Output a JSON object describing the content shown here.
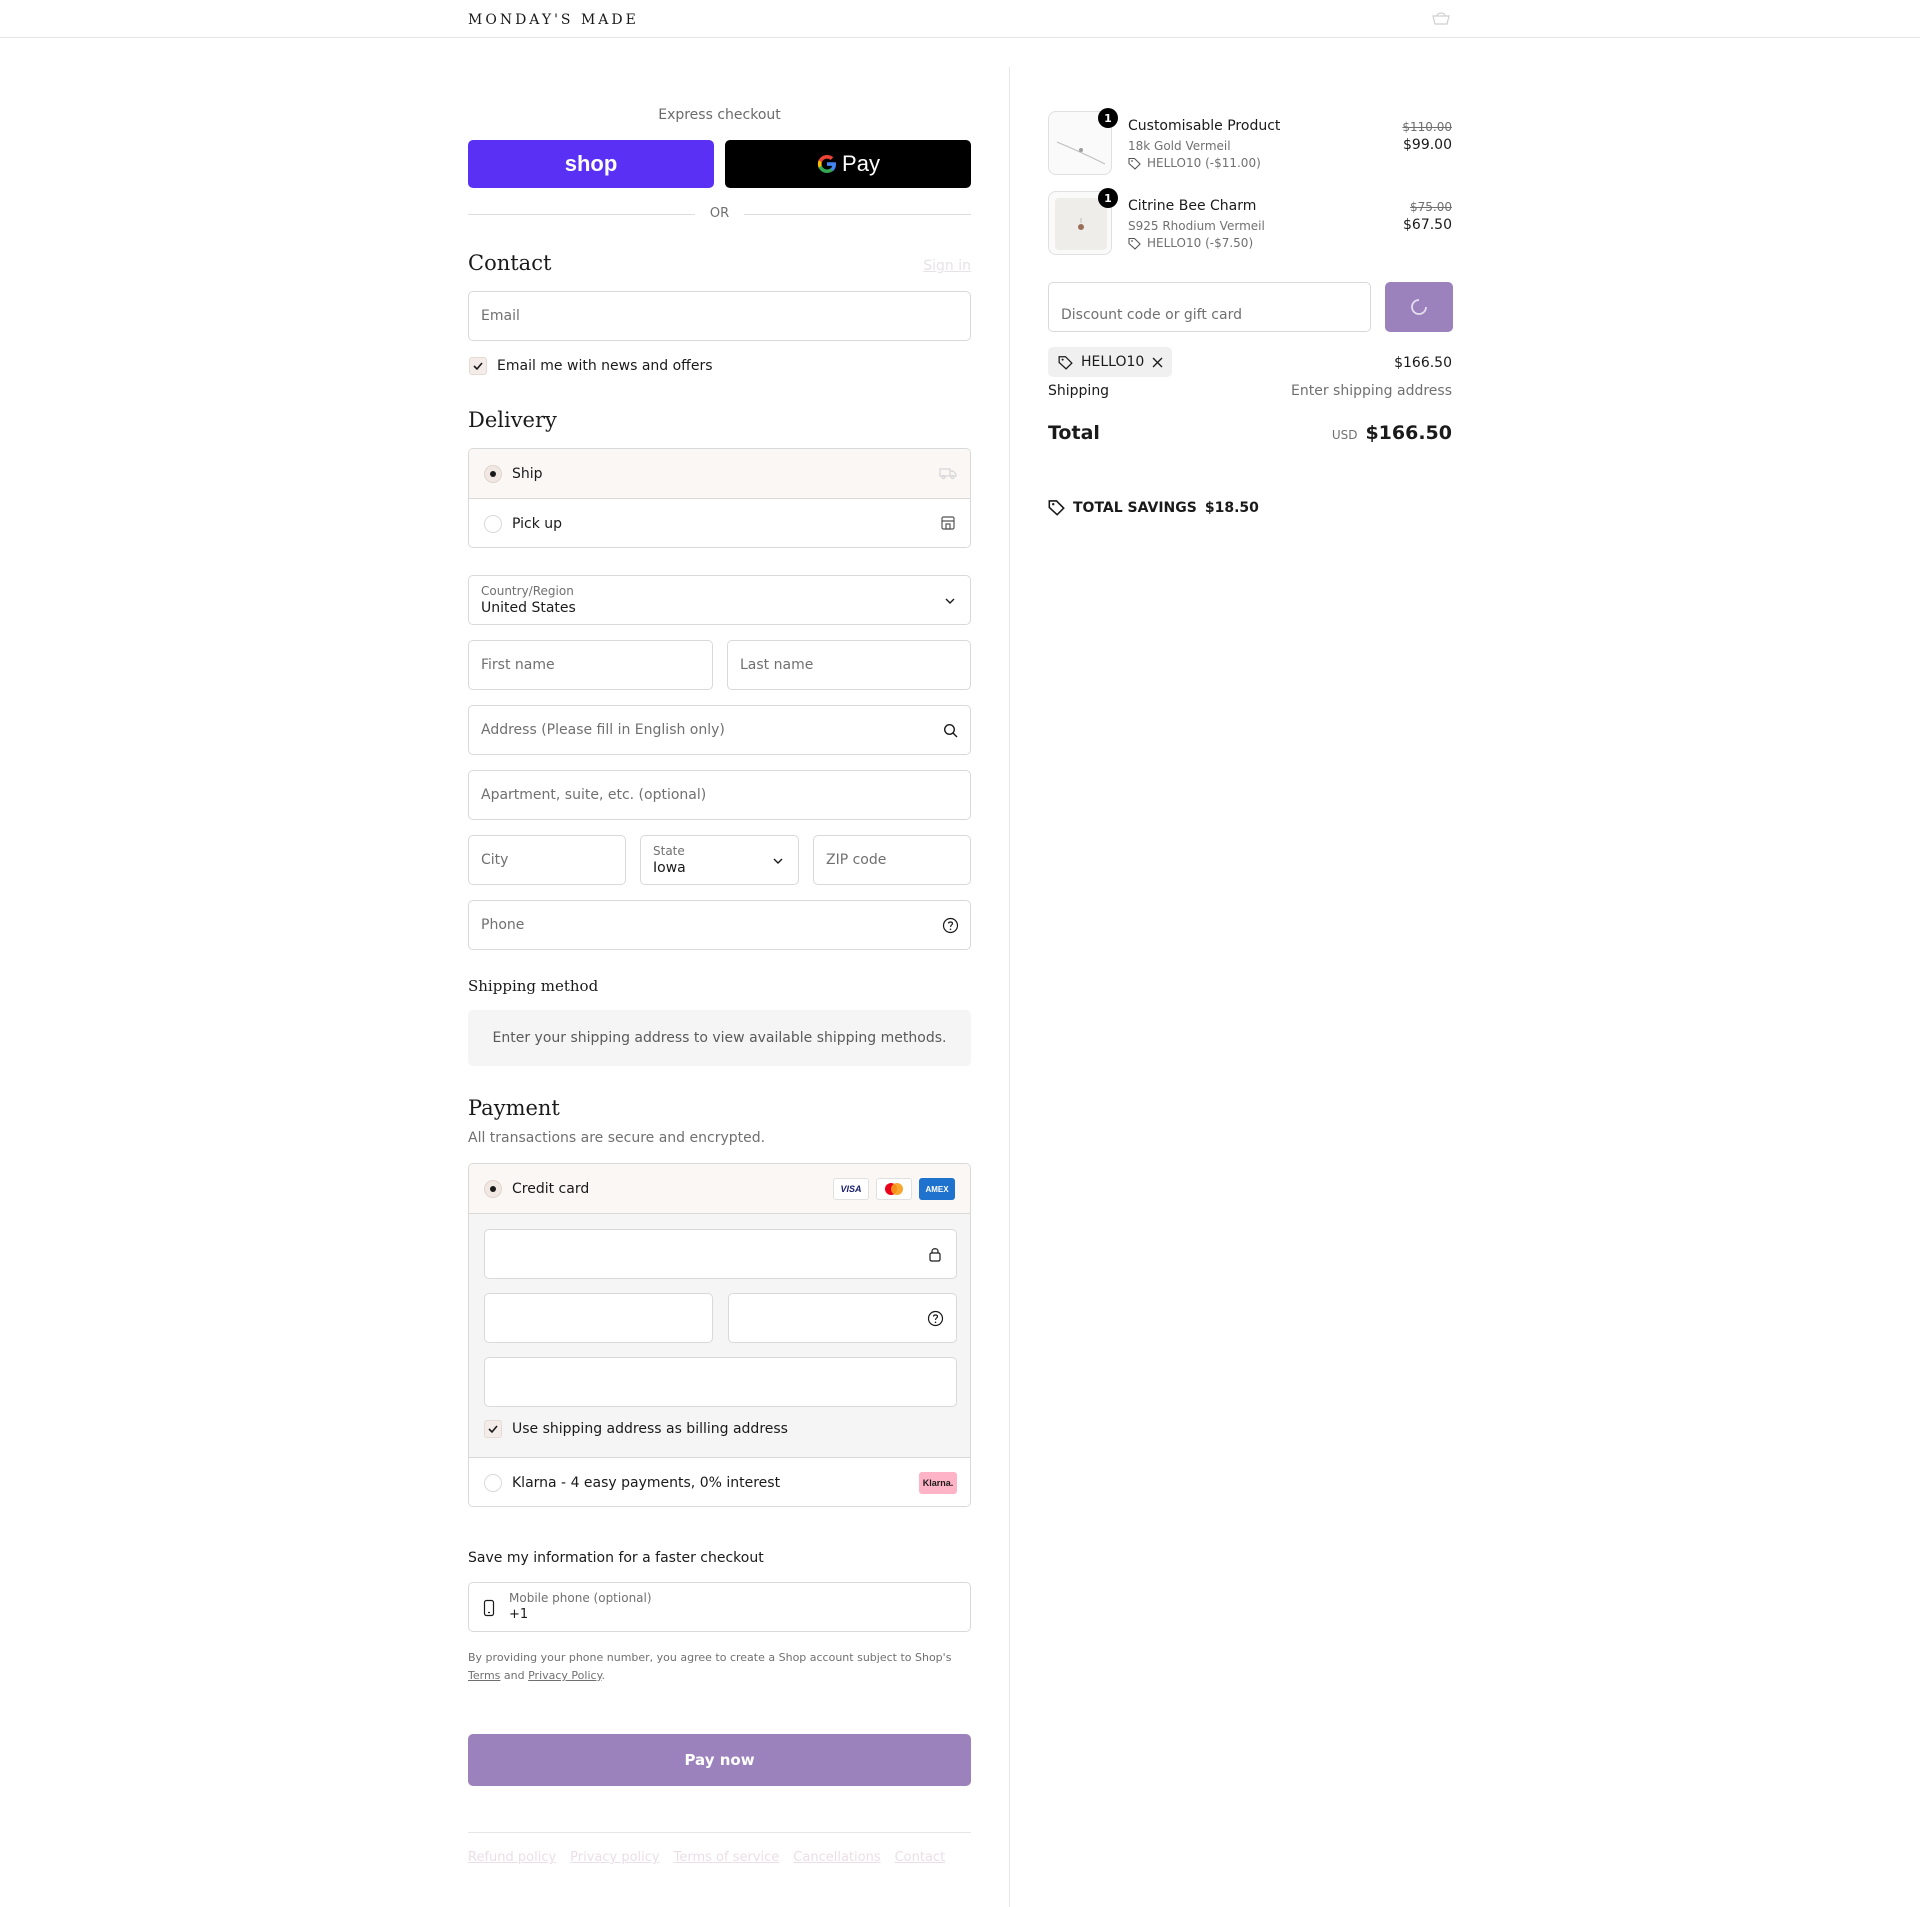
{
  "header": {
    "brand": "MONDAY'S MADE"
  },
  "express": {
    "label": "Express checkout",
    "shop_label": "shop",
    "gpay_label": "Pay",
    "or_label": "OR"
  },
  "contact": {
    "title": "Contact",
    "signin": "Sign in",
    "email_placeholder": "Email",
    "newsletter_label": "Email me with news and offers",
    "newsletter_checked": true
  },
  "delivery": {
    "title": "Delivery",
    "options": [
      {
        "label": "Ship",
        "selected": true,
        "icon": "truck-icon"
      },
      {
        "label": "Pick up",
        "selected": false,
        "icon": "store-icon"
      }
    ],
    "country_label": "Country/Region",
    "country_value": "United States",
    "first_name": "First name",
    "last_name": "Last name",
    "address": "Address (Please fill in English only)",
    "apartment": "Apartment, suite, etc. (optional)",
    "city": "City",
    "state_label": "State",
    "state_value": "Iowa",
    "zip": "ZIP code",
    "phone": "Phone"
  },
  "shipping_method": {
    "title": "Shipping method",
    "message": "Enter your shipping address to view available shipping methods."
  },
  "payment": {
    "title": "Payment",
    "subtitle": "All transactions are secure and encrypted.",
    "credit_card_label": "Credit card",
    "cards": [
      "VISA",
      "Mastercard",
      "AMEX"
    ],
    "billing_label": "Use shipping address as billing address",
    "klarna_label": "Klarna - 4 easy payments, 0% interest",
    "klarna_badge": "Klarna."
  },
  "save_info": {
    "title": "Save my information for a faster checkout",
    "mobile_label": "Mobile phone (optional)",
    "mobile_value": "+1",
    "legal_prefix": "By providing your phone number, you agree to create a Shop account subject to Shop's",
    "terms": "Terms",
    "and": "and",
    "privacy": "Privacy Policy",
    "period": "."
  },
  "pay_now": "Pay now",
  "footer_links": [
    "Refund policy",
    "Privacy policy",
    "Terms of service",
    "Cancellations",
    "Contact"
  ],
  "order": {
    "items": [
      {
        "qty": "1",
        "name": "Customisable Product",
        "variant": "18k Gold Vermeil",
        "discount": "HELLO10 (-$11.00)",
        "old_price": "$110.00",
        "price": "$99.00"
      },
      {
        "qty": "1",
        "name": "Citrine Bee Charm",
        "variant": "S925 Rhodium Vermeil",
        "discount": "HELLO10 (-$7.50)",
        "old_price": "$75.00",
        "price": "$67.50"
      }
    ],
    "discount_placeholder": "Discount code or gift card",
    "applied_code": "HELLO10",
    "subtotal": "$166.50",
    "shipping_label": "Shipping",
    "shipping_value": "Enter shipping address",
    "total_label": "Total",
    "currency": "USD",
    "total_value": "$166.50",
    "savings_label": "TOTAL SAVINGS",
    "savings_value": "$18.50"
  },
  "colors": {
    "accent": "#9b82bd",
    "shop_pay": "#5a31f4",
    "klarna": "#ffb3c7"
  }
}
